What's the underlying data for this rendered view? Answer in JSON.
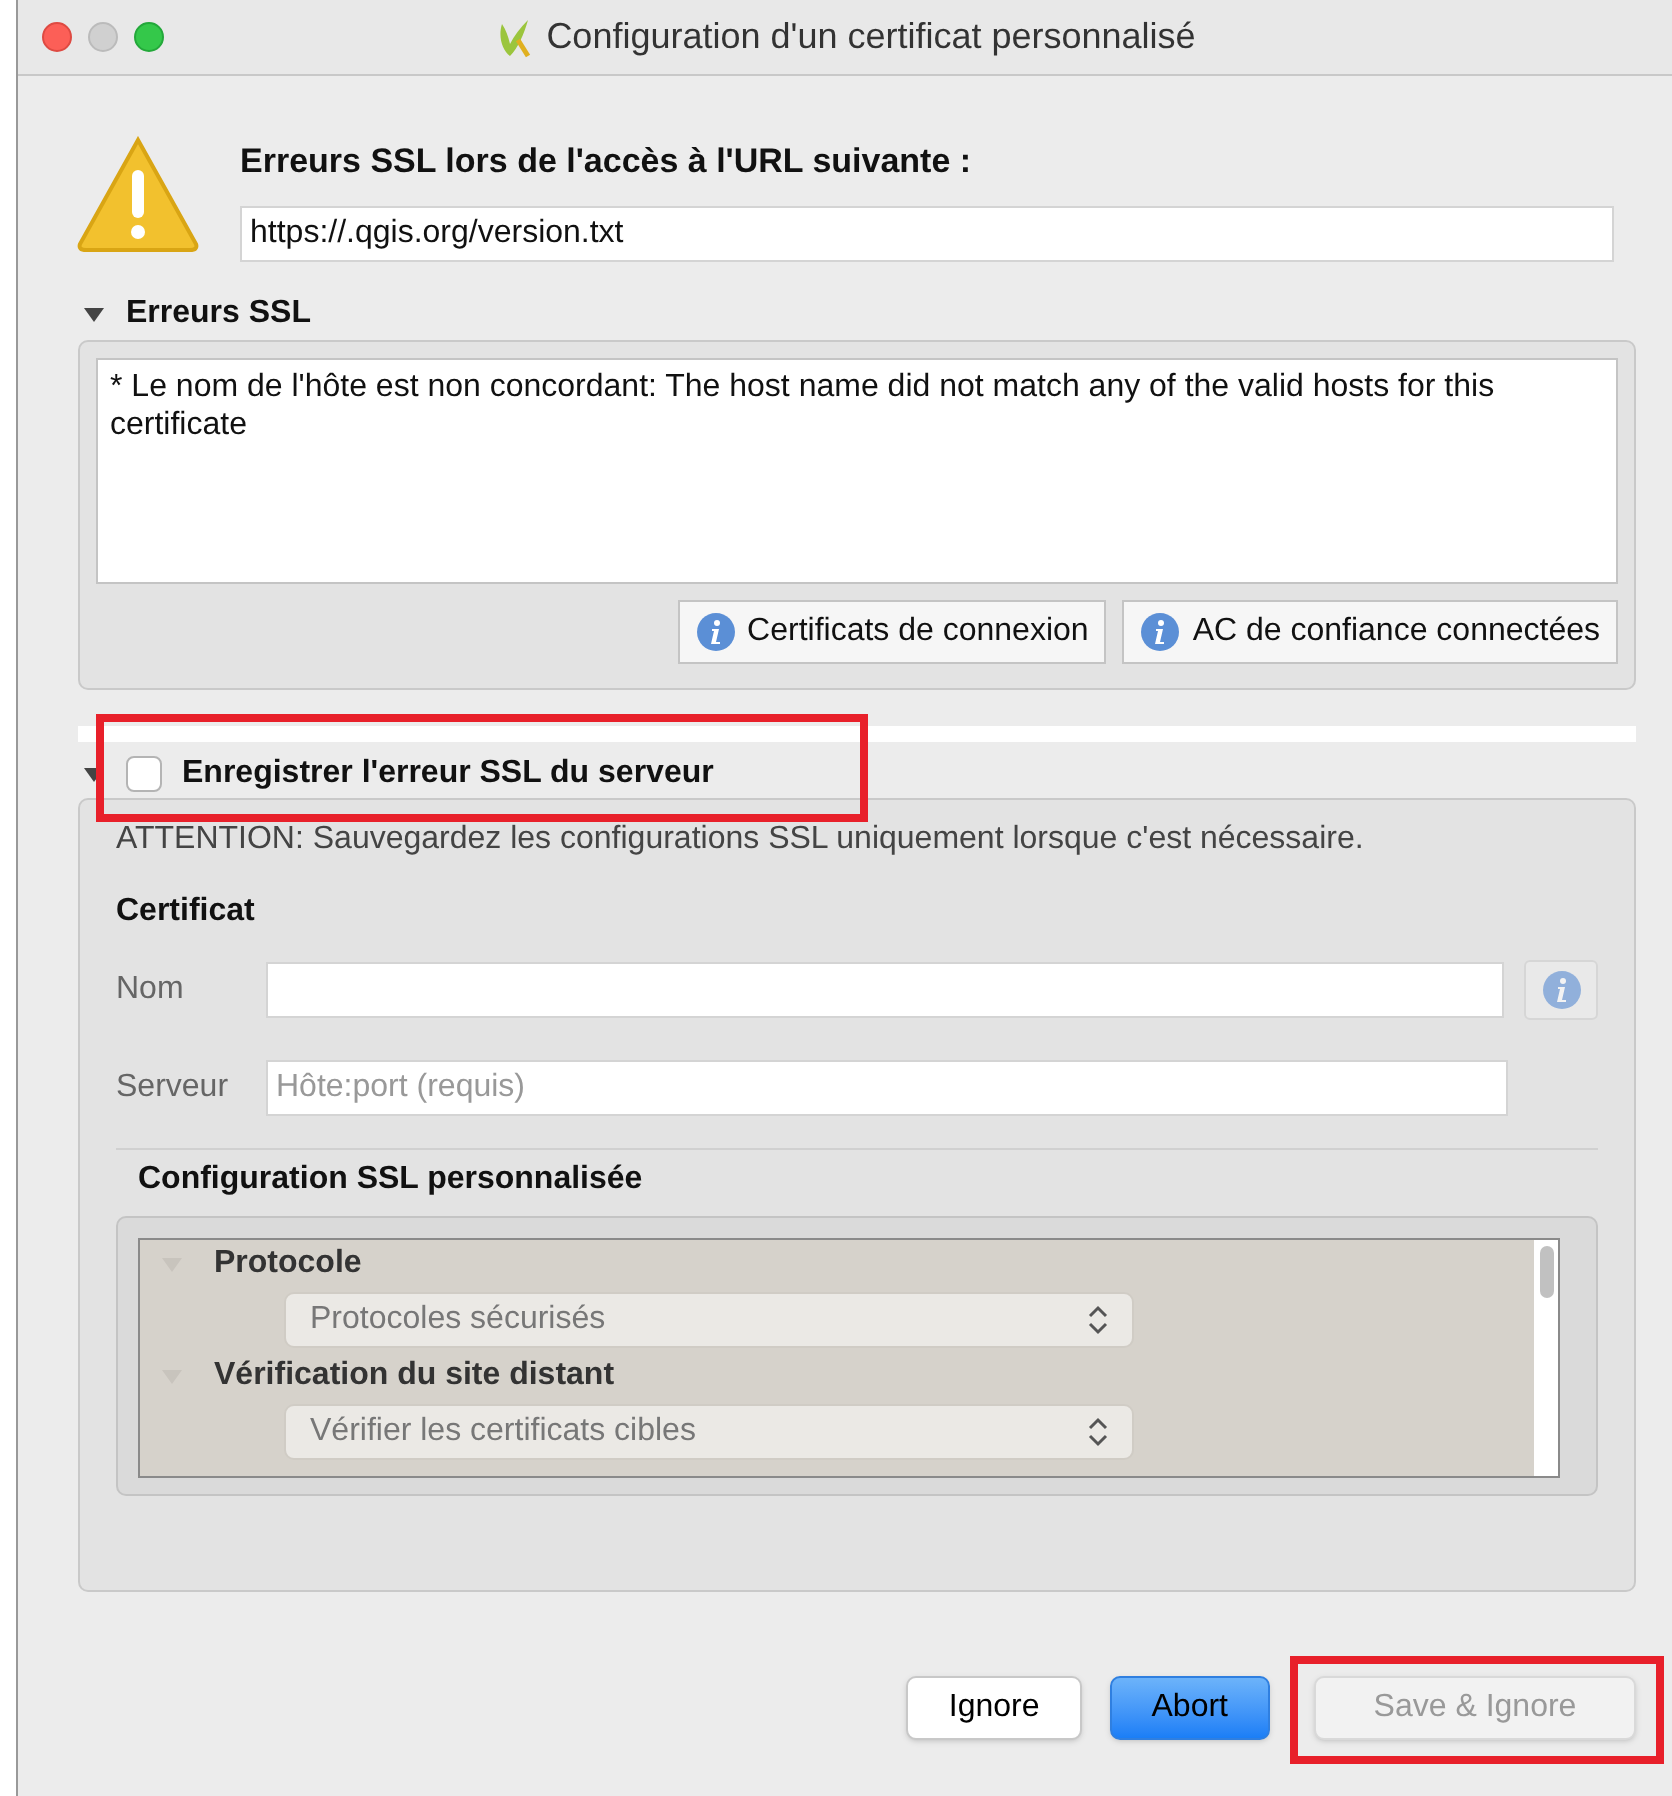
{
  "window": {
    "title": "Configuration d'un certificat personnalisé"
  },
  "header": {
    "label": "Erreurs SSL lors de l'accès à l'URL suivante :",
    "url": "https://.qgis.org/version.txt"
  },
  "errors_section": {
    "title": "Erreurs SSL",
    "expanded": true,
    "text": "* Le nom de l'hôte est non concordant: The host name did not match any of the valid hosts for this certificate",
    "buttons": [
      "Certificats de connexion",
      "AC de confiance connectées"
    ]
  },
  "save_section": {
    "title": "Enregistrer l'erreur SSL du serveur",
    "checked": false,
    "expanded": true,
    "highlighted": true,
    "warning": "ATTENTION: Sauvegardez les configurations SSL uniquement lorsque c'est nécessaire.",
    "certificate_title": "Certificat",
    "fields": [
      {
        "label": "Nom",
        "info": true
      },
      {
        "label": "Serveur",
        "placeholder": "Hôte:port (requis)",
        "info": false
      }
    ],
    "custom_title": "Configuration SSL personnalisée",
    "tree": [
      {
        "title": "Protocole",
        "expanded": true,
        "value": "Protocoles sécurisés"
      },
      {
        "title": "Vérification du site distant",
        "expanded": true,
        "value": "Vérifier les certificats cibles"
      }
    ]
  },
  "buttons": [
    {
      "label": "Ignore",
      "default": false,
      "disabled": false,
      "highlighted": false
    },
    {
      "label": "Abort",
      "default": true,
      "disabled": false,
      "highlighted": false
    },
    {
      "label": "Save & Ignore",
      "default": false,
      "disabled": true,
      "highlighted": true
    }
  ]
}
